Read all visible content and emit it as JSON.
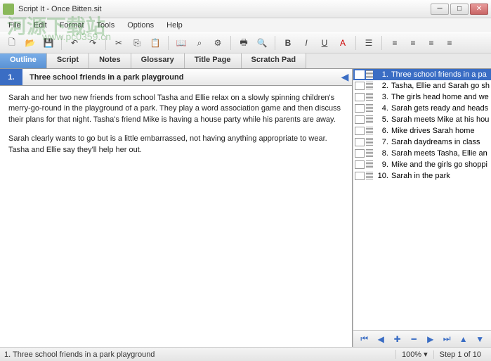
{
  "window": {
    "title": "Script It - Once Bitten.sit"
  },
  "menu": {
    "file": "File",
    "edit": "Edit",
    "format": "Format",
    "tools": "Tools",
    "options": "Options",
    "help": "Help"
  },
  "tabs": {
    "outline": "Outline",
    "script": "Script",
    "notes": "Notes",
    "glossary": "Glossary",
    "titlepage": "Title Page",
    "scratchpad": "Scratch Pad"
  },
  "step": {
    "number": "1.",
    "title": "Three school friends in a park playground",
    "para1": "Sarah and her two new friends from school Tasha and Ellie relax on a slowly spinning children's merry-go-round in the playground of a park.  They play a word association game and then discuss their plans for that night.  Tasha's friend Mike is having a house party while his parents are away.",
    "para2": "Sarah clearly wants to go but is a little embarrassed, not having anything appropriate to wear.  Tasha and Ellie say they'll help her out."
  },
  "steps": [
    {
      "n": "1.",
      "t": "Three school friends in a pa"
    },
    {
      "n": "2.",
      "t": "Tasha, Ellie and Sarah go sh"
    },
    {
      "n": "3.",
      "t": "The girls head home and we"
    },
    {
      "n": "4.",
      "t": "Sarah gets ready and heads"
    },
    {
      "n": "5.",
      "t": "Sarah meets Mike at his hou"
    },
    {
      "n": "6.",
      "t": "Mike drives Sarah home"
    },
    {
      "n": "7.",
      "t": "Sarah daydreams in class"
    },
    {
      "n": "8.",
      "t": "Sarah meets Tasha, Ellie an"
    },
    {
      "n": "9.",
      "t": "Mike and the girls go shoppi"
    },
    {
      "n": "10.",
      "t": "Sarah in the park"
    }
  ],
  "status": {
    "left": "1.  Three school friends in a park playground",
    "zoom": "100% ▾",
    "step": "Step 1 of 10"
  },
  "watermark": {
    "line1": "河源下载站",
    "line2": "www.pc0359.cn"
  }
}
